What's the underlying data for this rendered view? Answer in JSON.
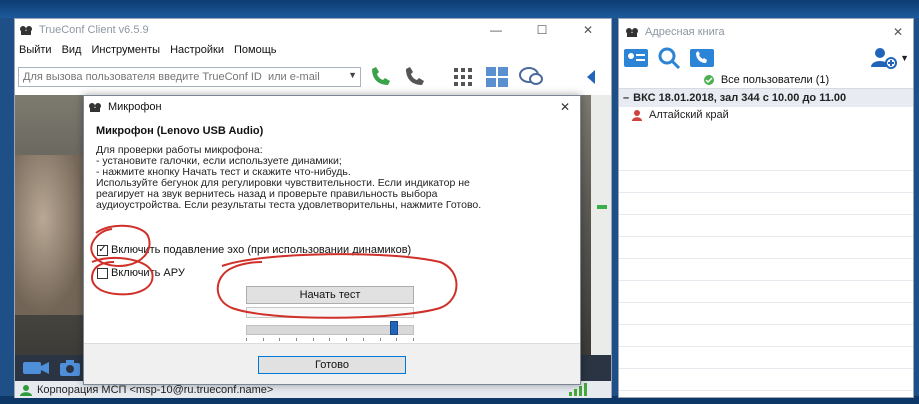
{
  "main_window": {
    "title": "TrueConf Client v6.5.9",
    "menu": [
      "Выйти",
      "Вид",
      "Инструменты",
      "Настройки",
      "Помощь"
    ],
    "call_input_placeholder": "Для вызова пользователя введите TrueConf ID  или e-mail",
    "status_text": "Корпорация МСП <msp-10@ru.trueconf.name>"
  },
  "address_book": {
    "title": "Адресная книга",
    "all_users": "Все пользователи (1)",
    "group": "ВКС 18.01.2018, зал 344 с 10.00 до 11.00",
    "contact": "Алтайский край"
  },
  "dialog": {
    "title": "Микрофон",
    "heading": "Микрофон (Lenovo USB Audio)",
    "instructions": "Для проверки работы микрофона:\n- установите галочки, если используете динамики;\n- нажмите кнопку Начать тест и скажите что-нибудь.\nИспользуйте бегунок для регулировки чувствительности. Если индикатор не\nреагирует на звук вернитесь назад и проверьте правильность выбора\nаудиоустройства. Если результаты теста удовлетворительны, нажмите Готово.",
    "echo_label": "Включить подавление эхо (при использовании динамиков)",
    "echo_checked": true,
    "agc_label": "Включить АРУ",
    "agc_checked": false,
    "start_test": "Начать тест",
    "done": "Готово",
    "sensitivity": 0.9
  },
  "colors": {
    "accent_blue": "#2264b8",
    "annotation_red": "#d0302a",
    "call_green": "#3aa34a"
  }
}
